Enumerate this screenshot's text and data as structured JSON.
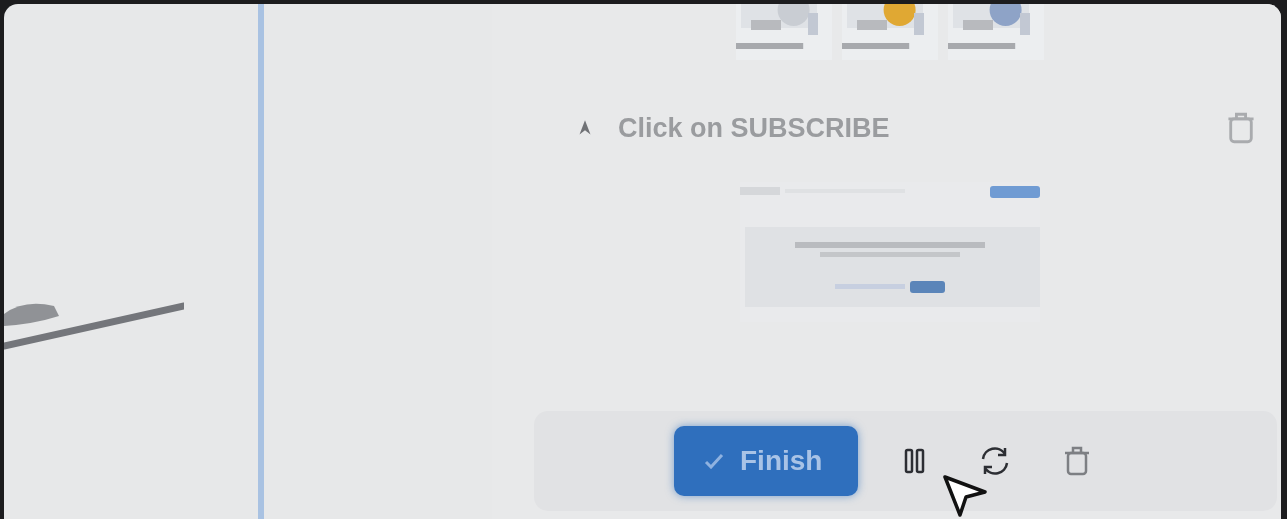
{
  "step": {
    "title": "Click on SUBSCRIBE"
  },
  "toolbar": {
    "finish_button": {
      "label": "Finish"
    }
  }
}
